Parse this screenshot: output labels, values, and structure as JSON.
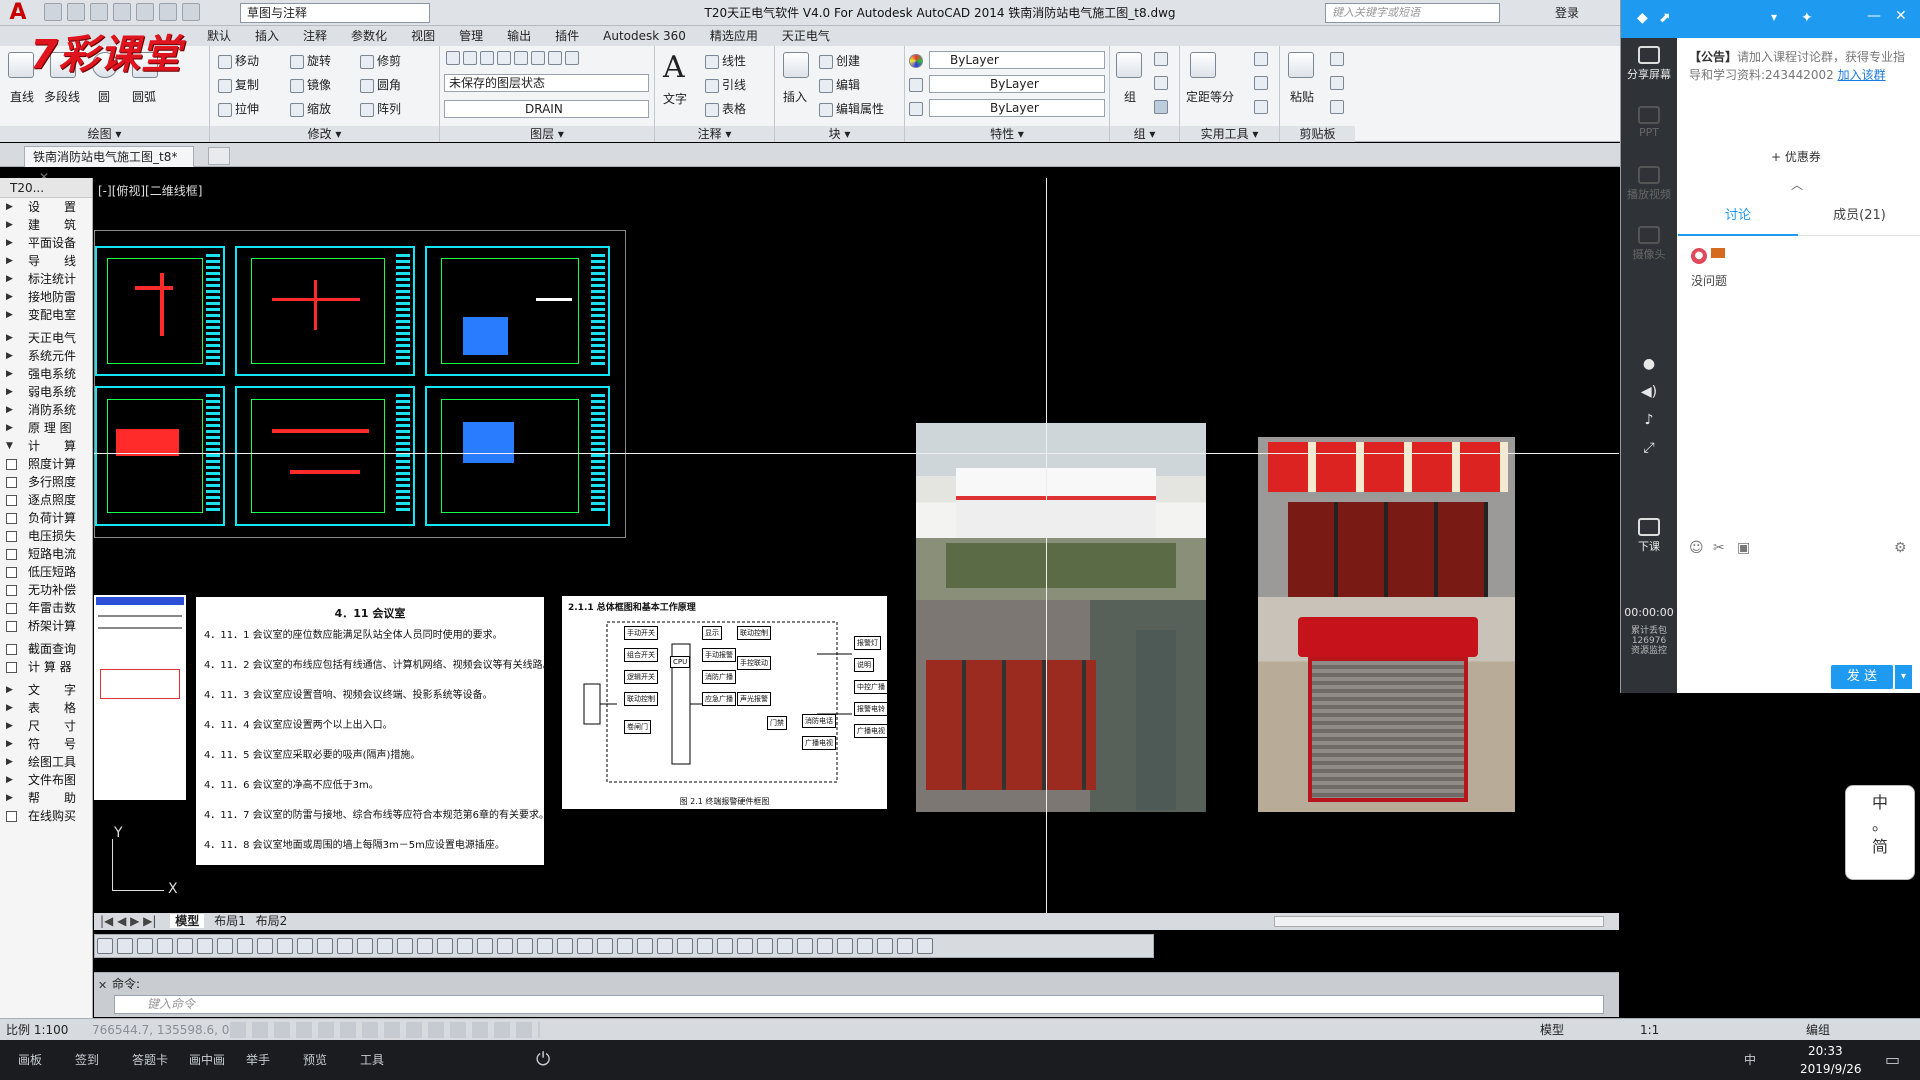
{
  "app": {
    "logo": "A",
    "workspace": "草图与注释",
    "window_title": "T20天正电气软件 V4.0 For Autodesk AutoCAD 2014    铁南消防站电气施工图_t8.dwg",
    "search_placeholder": "键入关键字或短语",
    "login": "登录",
    "brand": "7彩课堂"
  },
  "menus": [
    "默认",
    "插入",
    "注释",
    "参数化",
    "视图",
    "管理",
    "输出",
    "插件",
    "Autodesk 360",
    "精选应用",
    "天正电气"
  ],
  "ribbon": {
    "draw": {
      "label": "绘图 ▾",
      "tools": [
        "直线",
        "多段线",
        "圆",
        "圆弧"
      ]
    },
    "modify": {
      "label": "修改 ▾",
      "tools": [
        "移动",
        "旋转",
        "修剪",
        "复制",
        "镜像",
        "圆角",
        "拉伸",
        "缩放",
        "阵列"
      ]
    },
    "layer": {
      "label": "图层 ▾",
      "state": "未保存的图层状态",
      "current": "DRAIN"
    },
    "annotate": {
      "label": "注释 ▾",
      "text": "文字",
      "tools": [
        "线性",
        "引线",
        "表格"
      ]
    },
    "block": {
      "label": "块 ▾",
      "insert": "插入",
      "tools": [
        "创建",
        "编辑",
        "编辑属性"
      ]
    },
    "props": {
      "label": "特性 ▾",
      "color": "ByLayer",
      "linetype": "ByLayer",
      "lineweight": "ByLayer"
    },
    "group": {
      "label": "组 ▾",
      "tool": "组"
    },
    "utils": {
      "label": "实用工具 ▾",
      "tool": "定距等分"
    },
    "clipboard": {
      "label": "剪贴板",
      "tool": "粘贴"
    }
  },
  "doc_tab": "铁南消防站电气施工图_t8*",
  "sidebar": {
    "title": "T20...",
    "items": [
      {
        "label": "设　　置",
        "kind": "arrow"
      },
      {
        "label": "建　　筑",
        "kind": "arrow"
      },
      {
        "label": "平面设备",
        "kind": "arrow"
      },
      {
        "label": "导　　线",
        "kind": "arrow"
      },
      {
        "label": "标注统计",
        "kind": "arrow"
      },
      {
        "label": "接地防雷",
        "kind": "arrow"
      },
      {
        "label": "变配电室",
        "kind": "arrow"
      },
      {
        "label": "",
        "kind": "gap"
      },
      {
        "label": "天正电气",
        "kind": "arrow"
      },
      {
        "label": "系统元件",
        "kind": "arrow"
      },
      {
        "label": "强电系统",
        "kind": "arrow"
      },
      {
        "label": "弱电系统",
        "kind": "arrow"
      },
      {
        "label": "消防系统",
        "kind": "arrow"
      },
      {
        "label": "原 理 图",
        "kind": "arrow"
      },
      {
        "label": "计　　算",
        "kind": "open"
      },
      {
        "label": "照度计算",
        "kind": "icon"
      },
      {
        "label": "多行照度",
        "kind": "icon"
      },
      {
        "label": "逐点照度",
        "kind": "icon"
      },
      {
        "label": "负荷计算",
        "kind": "icon"
      },
      {
        "label": "电压损失",
        "kind": "icon"
      },
      {
        "label": "短路电流",
        "kind": "icon"
      },
      {
        "label": "低压短路",
        "kind": "icon"
      },
      {
        "label": "无功补偿",
        "kind": "icon"
      },
      {
        "label": "年雷击数",
        "kind": "icon"
      },
      {
        "label": "桥架计算",
        "kind": "icon"
      },
      {
        "label": "",
        "kind": "gap"
      },
      {
        "label": "截面查询",
        "kind": "icon"
      },
      {
        "label": "计 算 器",
        "kind": "icon"
      },
      {
        "label": "",
        "kind": "gap"
      },
      {
        "label": "文　　字",
        "kind": "arrow"
      },
      {
        "label": "表　　格",
        "kind": "arrow"
      },
      {
        "label": "尺　　寸",
        "kind": "arrow"
      },
      {
        "label": "符　　号",
        "kind": "arrow"
      },
      {
        "label": "绘图工具",
        "kind": "arrow"
      },
      {
        "label": "文件布图",
        "kind": "arrow"
      },
      {
        "label": "帮　　助",
        "kind": "arrow"
      },
      {
        "label": "在线购买",
        "kind": "icon"
      }
    ]
  },
  "canvas": {
    "view_label": "[-][俯视][二维线框]",
    "doc_title": "4．11 会议室",
    "doc_lines": [
      "4．11．1 会议室的座位数应能满足队站全体人员同时使用的要求。",
      "4．11．2 会议室的布线应包括有线通信、计算机网络、视频会议等有关线路。",
      "4．11．3 会议室应设置音响、视频会议终端、投影系统等设备。",
      "4．11．4 会议室应设置两个以上出入口。",
      "4．11．5 会议室应采取必要的吸声(隔声)措施。",
      "4．11．6 会议室的净高不应低于3m。",
      "4．11．7 会议室的防雷与接地、综合布线等应符合本规范第6章的有关要求。",
      "4．11．8 会议室地面或周围的墙上每隔3m－5m应设置电源插座。"
    ],
    "diagram_title": "2.1.1 总体框图和基本工作原理",
    "diagram_caption": "图 2.1 终端报警硬件框图",
    "diagram_blocks": [
      "手动开关",
      "组合开关",
      "逻辑开关",
      "联动控制",
      "CPU",
      "显示",
      "手动报警",
      "消防广播",
      "应急广播",
      "联动控制",
      "手控联动",
      "声光报警",
      "卷闸门",
      "门禁",
      "消防电话",
      "广播电视"
    ],
    "diagram_outputs": [
      "报警灯",
      "说明",
      "中控广播",
      "报警电铃",
      "广播电视"
    ],
    "ucs_y": "Y",
    "ucs_x": "X"
  },
  "layout_tabs": [
    "模型",
    "布局1",
    "布局2"
  ],
  "command": {
    "history": "命令:",
    "placeholder": "键入命令"
  },
  "status": {
    "scale": "比例 1:100",
    "coords": "766544.7, 135598.6, 0",
    "model": "模型",
    "anno": "1:1",
    "edit": "编组"
  },
  "taskbar": {
    "items": [
      "画板",
      "签到",
      "答题卡",
      "画中画",
      "举手",
      "预览",
      "工具"
    ],
    "time": "20:33",
    "date": "2019/9/26",
    "ime": "中"
  },
  "qq": {
    "announce_label": "【公告】",
    "announce_text": "请加入课程讨论群，获得专业指导和学习资料:243442002",
    "announce_link": "加入该群",
    "coupon": "优惠券",
    "tabs": [
      "讨论",
      "成员(21)"
    ],
    "message_text": "没问题",
    "tools": [
      {
        "label": "分享屏幕",
        "dim": false
      },
      {
        "label": "PPT",
        "dim": true
      },
      {
        "label": "播放视频",
        "dim": true
      },
      {
        "label": "摄像头",
        "dim": true
      },
      {
        "label": "下课",
        "dim": false
      }
    ],
    "timer": "00:00:00",
    "stats": "累计丢包\n126976\n资源监控",
    "send": "发 送"
  },
  "ime_panel": [
    "中",
    "。",
    "简"
  ]
}
